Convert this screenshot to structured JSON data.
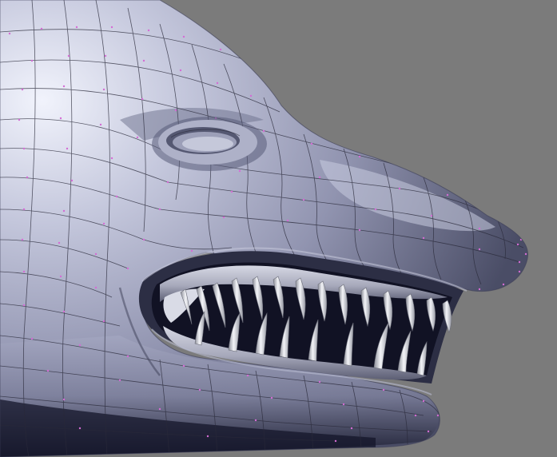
{
  "viewport": {
    "background_color": "#7b7b7b"
  },
  "model": {
    "subject": "shark head",
    "shading": "solid",
    "wireframe_overlay": true,
    "vertex_dots_visible": true,
    "colors": {
      "skin_light": "#e6e8f6",
      "skin_mid": "#9b9eb8",
      "skin_dark": "#2e3148",
      "mouth_interior": "#111224",
      "wire": "#2a2a3a",
      "vertex": "#d46cd4",
      "teeth": "#dcdde2"
    }
  }
}
